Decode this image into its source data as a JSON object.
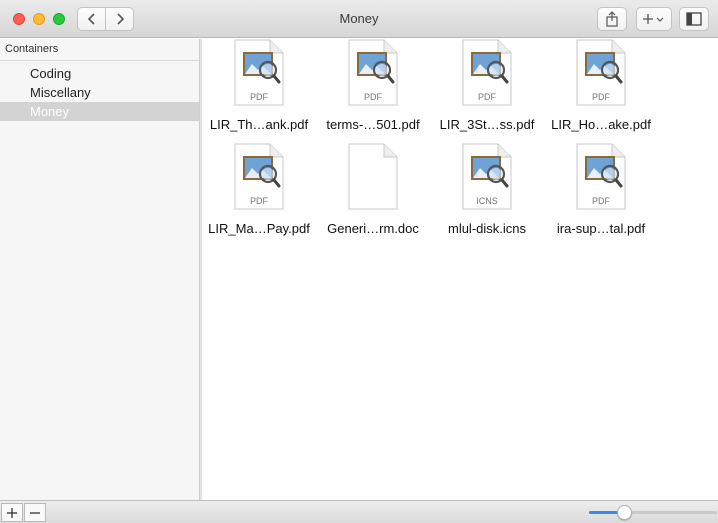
{
  "window": {
    "title": "Money",
    "colors": {
      "close": "#fc5f57",
      "minimize": "#fdbc2e",
      "maximize": "#28c840",
      "selection": "#d3d3d3",
      "slider_accent": "#3b88f5"
    }
  },
  "toolbar": {
    "back_icon": "chevron-left-icon",
    "forward_icon": "chevron-right-icon",
    "share_icon": "share-icon",
    "add_icon": "plus-dropdown-icon",
    "sidebar_icon": "sidebar-toggle-icon"
  },
  "sidebar": {
    "header": "Containers",
    "items": [
      {
        "label": "Coding",
        "selected": false
      },
      {
        "label": "Miscellany",
        "selected": false
      },
      {
        "label": "Money",
        "selected": true
      }
    ]
  },
  "files": [
    {
      "name": "LIR_Th…ank.pdf",
      "type_label": "PDF",
      "icon": "preview-document-icon"
    },
    {
      "name": "terms-…501.pdf",
      "type_label": "PDF",
      "icon": "preview-document-icon"
    },
    {
      "name": "LIR_3St…ss.pdf",
      "type_label": "PDF",
      "icon": "preview-document-icon"
    },
    {
      "name": "LIR_Ho…ake.pdf",
      "type_label": "PDF",
      "icon": "preview-document-icon"
    },
    {
      "name": "LIR_Ma…Pay.pdf",
      "type_label": "PDF",
      "icon": "preview-document-icon"
    },
    {
      "name": "Generi…rm.doc",
      "type_label": "",
      "icon": "blank-document-icon"
    },
    {
      "name": "mlul-disk.icns",
      "type_label": "ICNS",
      "icon": "preview-document-icon"
    },
    {
      "name": "ira-sup…tal.pdf",
      "type_label": "PDF",
      "icon": "preview-document-icon"
    }
  ],
  "bottombar": {
    "add_icon": "plus-icon",
    "remove_icon": "minus-icon",
    "zoom_slider_level": 0.25
  }
}
